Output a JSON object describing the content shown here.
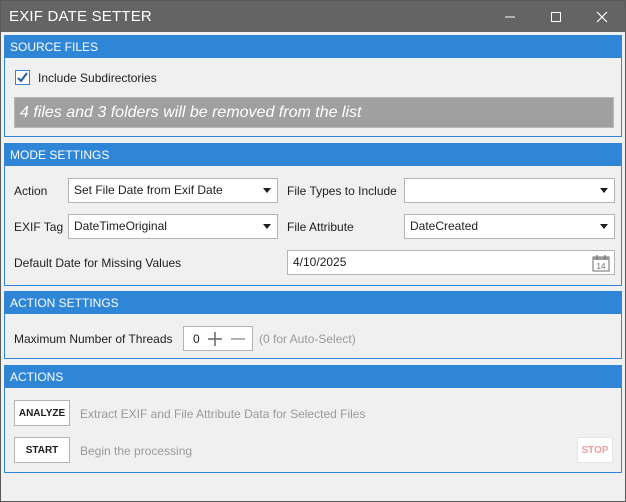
{
  "window": {
    "title": "EXIF DATE SETTER",
    "controls": {
      "minimize_icon": "minimize-icon",
      "maximize_icon": "maximize-icon",
      "close_icon": "close-icon"
    }
  },
  "source_files": {
    "header": "SOURCE FILES",
    "include_subdirectories": {
      "label": "Include Subdirectories",
      "checked": true
    },
    "info_message": "4 files and 3 folders will be removed from the list"
  },
  "mode_settings": {
    "header": "MODE SETTINGS",
    "action": {
      "label": "Action",
      "value": "Set File Date from Exif Date"
    },
    "file_types": {
      "label": "File Types to Include",
      "value": ""
    },
    "exif_tag": {
      "label": "EXIF Tag",
      "value": "DateTimeOriginal"
    },
    "file_attribute": {
      "label": "File Attribute",
      "value": "DateCreated"
    },
    "default_date": {
      "label": "Default Date for Missing Values",
      "value": "4/10/2025",
      "calendar_day": "14"
    }
  },
  "action_settings": {
    "header": "ACTION SETTINGS",
    "max_threads": {
      "label": "Maximum Number of Threads",
      "value": "0",
      "hint": "(0 for Auto-Select)"
    }
  },
  "actions": {
    "header": "ACTIONS",
    "analyze": {
      "label": "ANALYZE",
      "description": "Extract EXIF and File Attribute Data for Selected Files"
    },
    "start": {
      "label": "START",
      "description": "Begin the processing"
    },
    "stop": {
      "label": "STOP"
    }
  },
  "colors": {
    "accent": "#2f86d6",
    "titlebar": "#646464",
    "banner": "#a0a0a0",
    "stop_text": "#f2a0a0"
  }
}
